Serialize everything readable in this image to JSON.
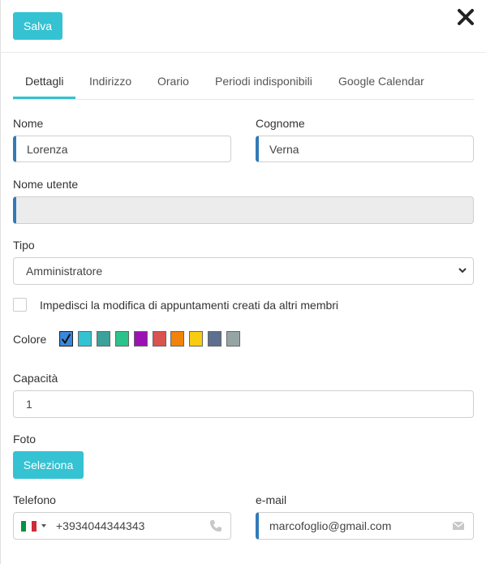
{
  "header": {
    "save_label": "Salva"
  },
  "tabs": [
    {
      "label": "Dettagli",
      "active": true
    },
    {
      "label": "Indirizzo",
      "active": false
    },
    {
      "label": "Orario",
      "active": false
    },
    {
      "label": "Periodi indisponibili",
      "active": false
    },
    {
      "label": "Google Calendar",
      "active": false
    }
  ],
  "form": {
    "nome_label": "Nome",
    "nome_value": "Lorenza",
    "cognome_label": "Cognome",
    "cognome_value": "Verna",
    "nome_utente_label": "Nome utente",
    "nome_utente_value": "",
    "tipo_label": "Tipo",
    "tipo_value": "Amministratore",
    "impedisci_label": "Impedisci la modifica di appuntamenti creati da altri membri",
    "impedisci_checked": false,
    "colore_label": "Colore",
    "colors": [
      "#3b87d8",
      "#35c2d2",
      "#3aa29a",
      "#2cc38b",
      "#9b12b4",
      "#d9534f",
      "#f0830b",
      "#f7cc11",
      "#5d7090",
      "#95a5a6"
    ],
    "selected_color_index": 0,
    "capacita_label": "Capacità",
    "capacita_value": "1",
    "foto_label": "Foto",
    "seleziona_label": "Seleziona",
    "telefono_label": "Telefono",
    "telefono_value": "+3934044344343",
    "email_label": "e-mail",
    "email_value": "marcofoglio@gmail.com"
  },
  "icons": {
    "close": "close-icon",
    "check": "checkmark-icon",
    "phone": "phone-icon",
    "email": "envelope-icon",
    "select": "chevron-down-icon",
    "flag": "italy-flag-icon"
  }
}
